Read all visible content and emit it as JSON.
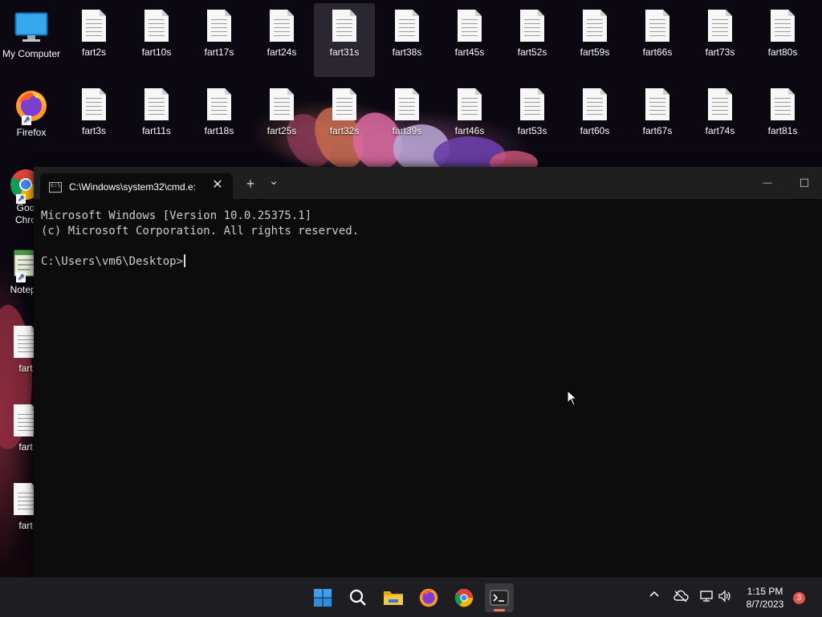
{
  "desktop": {
    "icons_top": [
      {
        "label": "fart2s"
      },
      {
        "label": "fart10s"
      },
      {
        "label": "fart17s"
      },
      {
        "label": "fart24s"
      },
      {
        "label": "fart31s"
      },
      {
        "label": "fart38s"
      },
      {
        "label": "fart45s"
      },
      {
        "label": "fart52s"
      },
      {
        "label": "fart59s"
      },
      {
        "label": "fart66s"
      },
      {
        "label": "fart73s"
      },
      {
        "label": "fart80s"
      }
    ],
    "icons_second": [
      {
        "label": "fart3s"
      },
      {
        "label": "fart11s"
      },
      {
        "label": "fart18s"
      },
      {
        "label": "fart25s"
      },
      {
        "label": "fart32s"
      },
      {
        "label": "fart39s"
      },
      {
        "label": "fart46s"
      },
      {
        "label": "fart53s"
      },
      {
        "label": "fart60s"
      },
      {
        "label": "fart67s"
      },
      {
        "label": "fart74s"
      },
      {
        "label": "fart81s"
      }
    ],
    "left_column": [
      {
        "label": "My Computer",
        "icon": "monitor-icon"
      },
      {
        "label": "Firefox",
        "icon": "firefox-icon"
      },
      {
        "label": "Goo",
        "label2": "Chro",
        "icon": "chrome-icon"
      },
      {
        "label": "Notepa",
        "icon": "notepad-icon"
      },
      {
        "label": "fart",
        "icon": "file-icon"
      },
      {
        "label": "fart",
        "icon": "file-icon"
      },
      {
        "label": "fart",
        "icon": "file-icon"
      }
    ]
  },
  "terminal": {
    "tab_title": "C:\\Windows\\system32\\cmd.e:",
    "tab_close": "✕",
    "new_tab": "+",
    "dropdown": "⌄",
    "minimize": "—",
    "maximize": "☐",
    "lines": [
      "Microsoft Windows [Version 10.0.25375.1]",
      "(c) Microsoft Corporation. All rights reserved.",
      "",
      "C:\\Users\\vm6\\Desktop>"
    ]
  },
  "taskbar": {
    "apps": [
      {
        "name": "start",
        "icon": "windows-logo-icon"
      },
      {
        "name": "search",
        "icon": "search-icon"
      },
      {
        "name": "file-explorer",
        "icon": "folder-icon"
      },
      {
        "name": "firefox",
        "icon": "firefox-icon"
      },
      {
        "name": "chrome",
        "icon": "chrome-icon"
      },
      {
        "name": "terminal",
        "icon": "terminal-icon",
        "active": true
      }
    ],
    "tray": {
      "chevron": "^",
      "time": "1:15 PM",
      "date": "8/7/2023",
      "notifications": "3"
    }
  },
  "colors": {
    "accent_indicator": "#e87a5a",
    "notification_badge": "#e3564b",
    "terminal_bg": "#0c0c0c",
    "titlebar_bg": "#1f1f1f",
    "taskbar_bg": "#1e1e22"
  }
}
